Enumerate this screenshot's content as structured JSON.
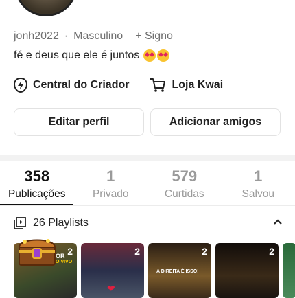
{
  "profile": {
    "username": "jonh2022",
    "gender": "Masculino",
    "signo": "+ Signo",
    "bio": "fé e deus que ele é juntos"
  },
  "links": {
    "creator_center": "Central do Criador",
    "store": "Loja Kwai"
  },
  "buttons": {
    "edit_profile": "Editar perfil",
    "add_friends": "Adicionar amigos"
  },
  "stats": [
    {
      "value": "358",
      "label": "Publicações",
      "active": true
    },
    {
      "value": "1",
      "label": "Privado"
    },
    {
      "value": "579",
      "label": "Curtidas"
    },
    {
      "value": "1",
      "label": "Salvou"
    }
  ],
  "playlists": {
    "title": "26 Playlists",
    "thumb_counts": [
      "2",
      "2",
      "2",
      "2"
    ],
    "thumb1_caption": "ADOR",
    "thumb1_sub": "AO VIVO",
    "thumb3_caption": "A DIREITA É ISSO!"
  },
  "colors": {
    "active_text": "#111111",
    "inactive_text": "#9a9a9a",
    "divider": "#f2f2f2"
  }
}
